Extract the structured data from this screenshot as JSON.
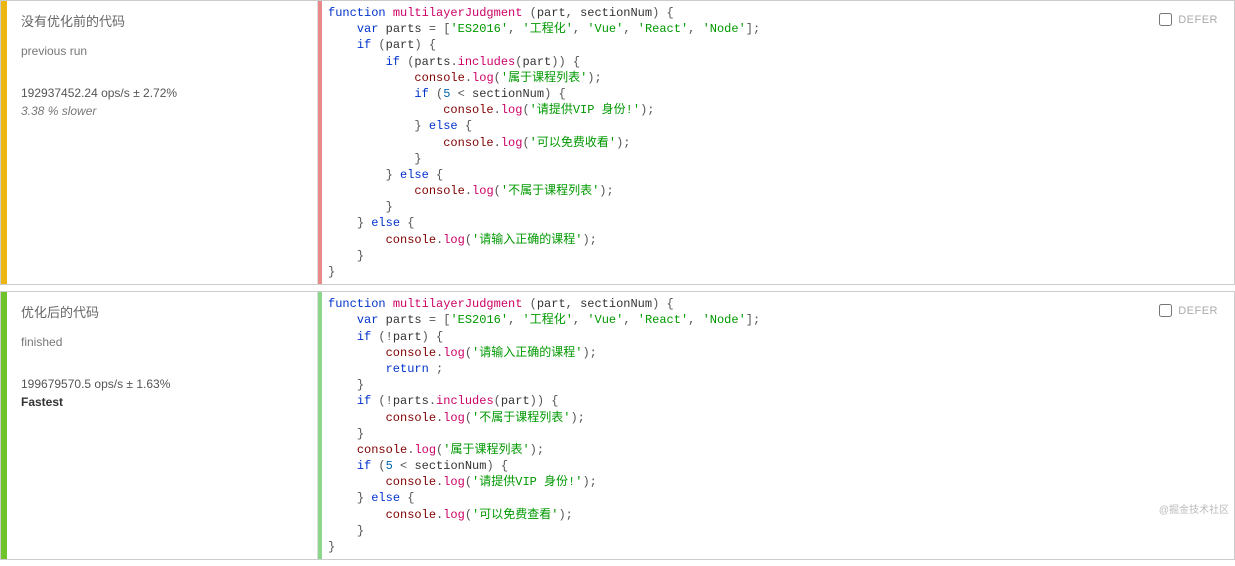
{
  "rows": [
    {
      "title": "没有优化前的代码",
      "status": "previous run",
      "ops": "192937452.24 ops/s ± 2.72%",
      "result_label": "3.38 % slower",
      "result_kind": "slower",
      "defer_checked": false,
      "defer_label": "DEFER",
      "code": {
        "fn_name": "multilayerJudgment",
        "params": [
          "part",
          "sectionNum"
        ],
        "parts_array": [
          "ES2016",
          "工程化",
          "Vue",
          "React",
          "Node"
        ],
        "s_belongs": "属于课程列表",
        "s_vip": "请提供VIP 身份!",
        "s_free": "可以免费收看",
        "s_not_belongs": "不属于课程列表",
        "s_input": "请输入正确的课程",
        "num": 5
      }
    },
    {
      "title": "优化后的代码",
      "status": "finished",
      "ops": "199679570.5 ops/s ± 1.63%",
      "result_label": "Fastest",
      "result_kind": "fastest",
      "defer_checked": false,
      "defer_label": "DEFER",
      "code": {
        "fn_name": "multilayerJudgment",
        "params": [
          "part",
          "sectionNum"
        ],
        "parts_array": [
          "ES2016",
          "工程化",
          "Vue",
          "React",
          "Node"
        ],
        "s_input": "请输入正确的课程",
        "s_not_belongs": "不属于课程列表",
        "s_belongs": "属于课程列表",
        "s_vip": "请提供VIP 身份!",
        "s_free": "可以免费查看",
        "num": 5
      }
    }
  ],
  "watermark": "@掘金技术社区"
}
